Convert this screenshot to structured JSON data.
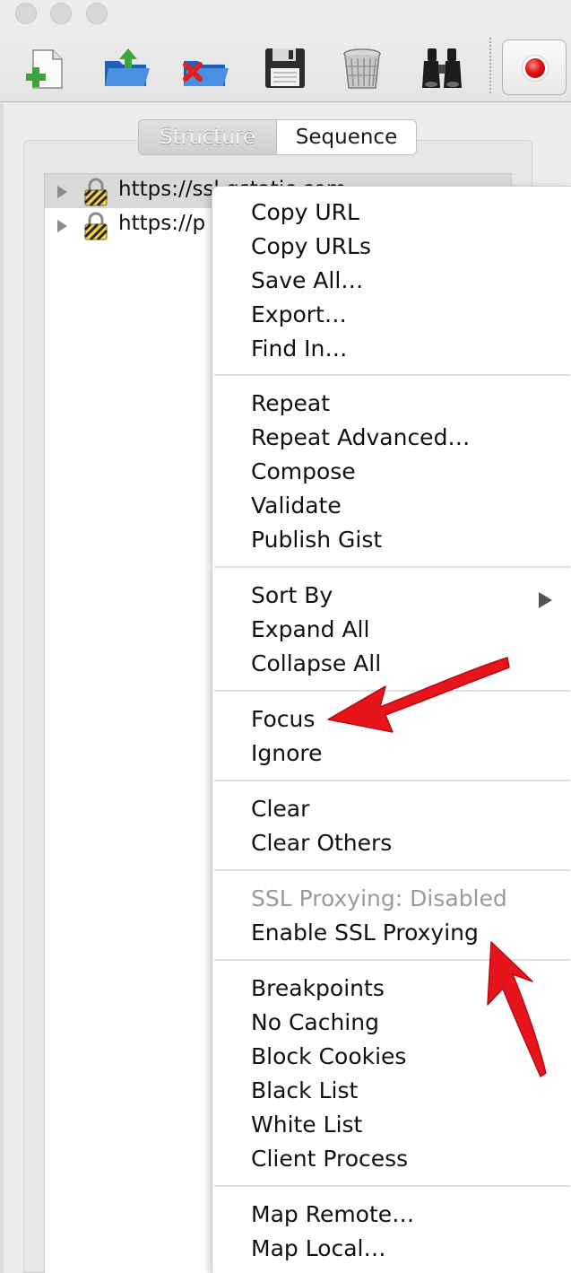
{
  "toolbar": {
    "tools": [
      {
        "icon": "new-session-icon"
      },
      {
        "icon": "open-session-icon"
      },
      {
        "icon": "close-session-icon"
      },
      {
        "icon": "save-icon"
      },
      {
        "icon": "trash-icon"
      },
      {
        "icon": "binoculars-icon"
      }
    ],
    "record_icon": "record-icon"
  },
  "view_tabs": {
    "structure": "Structure",
    "sequence": "Sequence",
    "selected": "Sequence"
  },
  "tree": {
    "rows": [
      {
        "host": "https://ssl.gstatic.com",
        "selected": true
      },
      {
        "host": "https://p",
        "selected": false
      }
    ]
  },
  "context_menu": {
    "groups": [
      {
        "items": [
          "Copy URL",
          "Copy URLs",
          "Save All…",
          "Export…",
          "Find In…"
        ]
      },
      {
        "items": [
          "Repeat",
          "Repeat Advanced…",
          "Compose",
          "Validate",
          "Publish Gist"
        ]
      },
      {
        "items": [
          "Sort By",
          "Expand All",
          "Collapse All"
        ]
      },
      {
        "items": [
          "Focus",
          "Ignore"
        ]
      },
      {
        "items": [
          "Clear",
          "Clear Others"
        ]
      },
      {
        "items": [
          "SSL Proxying: Disabled",
          "Enable SSL Proxying"
        ]
      },
      {
        "items": [
          "Breakpoints",
          "No Caching",
          "Block Cookies",
          "Black List",
          "White List",
          "Client Process"
        ]
      },
      {
        "items": [
          "Map Remote…",
          "Map Local…"
        ]
      }
    ],
    "disabled_items": [
      "SSL Proxying: Disabled"
    ],
    "submenu_items": [
      "Sort By"
    ]
  },
  "annotations": {
    "arrow_color": "#e8141c",
    "pointing_to": [
      "Focus",
      "Enable SSL Proxying"
    ]
  }
}
